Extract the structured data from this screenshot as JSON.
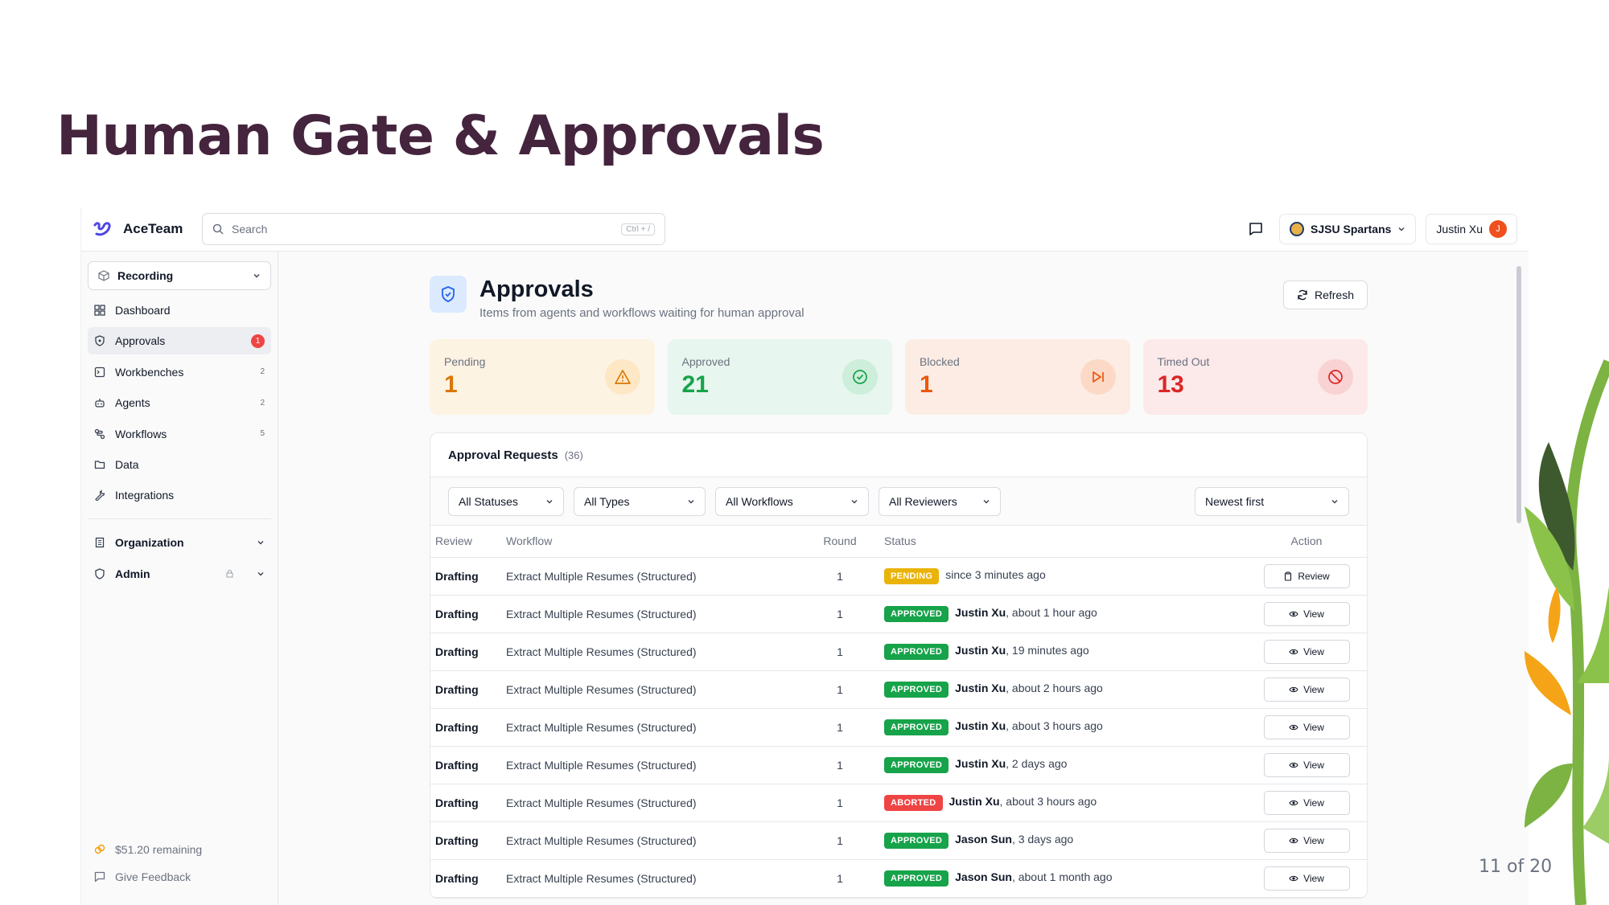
{
  "slide": {
    "title": "Human Gate & Approvals",
    "page": "11 of 20"
  },
  "topbar": {
    "brand": "AceTeam",
    "search_placeholder": "Search",
    "search_shortcut": "Ctrl + /",
    "org": "SJSU Spartans",
    "user": "Justin Xu",
    "user_initial": "J"
  },
  "sidebar": {
    "recording_label": "Recording",
    "items": [
      {
        "label": "Dashboard",
        "icon": "grid-icon"
      },
      {
        "label": "Approvals",
        "icon": "shield-icon",
        "badge": "1"
      },
      {
        "label": "Workbenches",
        "icon": "workbench-icon",
        "count": "2"
      },
      {
        "label": "Agents",
        "icon": "bot-icon",
        "count": "2"
      },
      {
        "label": "Workflows",
        "icon": "workflow-icon",
        "count": "5"
      },
      {
        "label": "Data",
        "icon": "folder-icon"
      },
      {
        "label": "Integrations",
        "icon": "wrench-icon"
      }
    ],
    "groups": [
      {
        "label": "Organization",
        "icon": "building-icon"
      },
      {
        "label": "Admin",
        "icon": "shield-icon"
      }
    ],
    "remaining": "$51.20 remaining",
    "feedback": "Give Feedback"
  },
  "page": {
    "title": "Approvals",
    "subtitle": "Items from agents and workflows waiting for human approval",
    "refresh_label": "Refresh"
  },
  "stats": [
    {
      "label": "Pending",
      "value": "1",
      "color": "#d97706",
      "bg": "#fdf3e2",
      "icon_bg": "#fde7c4"
    },
    {
      "label": "Approved",
      "value": "21",
      "color": "#16a34a",
      "bg": "#e7f6ee",
      "icon_bg": "#cdeedb"
    },
    {
      "label": "Blocked",
      "value": "1",
      "color": "#ea580c",
      "bg": "#fdece4",
      "icon_bg": "#fcd9c7"
    },
    {
      "label": "Timed Out",
      "value": "13",
      "color": "#dc2626",
      "bg": "#fce9ea",
      "icon_bg": "#f9d2d4"
    }
  ],
  "requests": {
    "title": "Approval Requests",
    "count": "(36)",
    "filters": [
      "All Statuses",
      "All Types",
      "All Workflows",
      "All Reviewers"
    ],
    "sort": "Newest first",
    "columns": {
      "review": "Review",
      "workflow": "Workflow",
      "round": "Round",
      "status": "Status",
      "action": "Action"
    },
    "rows": [
      {
        "review": "Drafting",
        "workflow": "Extract Multiple Resumes (Structured)",
        "round": "1",
        "status": "PENDING",
        "kind": "pending",
        "by": "",
        "when": "since 3 minutes ago",
        "action": "Review"
      },
      {
        "review": "Drafting",
        "workflow": "Extract Multiple Resumes (Structured)",
        "round": "1",
        "status": "APPROVED",
        "kind": "approved",
        "by": "Justin Xu",
        "when": ", about 1 hour ago",
        "action": "View"
      },
      {
        "review": "Drafting",
        "workflow": "Extract Multiple Resumes (Structured)",
        "round": "1",
        "status": "APPROVED",
        "kind": "approved",
        "by": "Justin Xu",
        "when": ", 19 minutes ago",
        "action": "View"
      },
      {
        "review": "Drafting",
        "workflow": "Extract Multiple Resumes (Structured)",
        "round": "1",
        "status": "APPROVED",
        "kind": "approved",
        "by": "Justin Xu",
        "when": ", about 2 hours ago",
        "action": "View"
      },
      {
        "review": "Drafting",
        "workflow": "Extract Multiple Resumes (Structured)",
        "round": "1",
        "status": "APPROVED",
        "kind": "approved",
        "by": "Justin Xu",
        "when": ", about 3 hours ago",
        "action": "View"
      },
      {
        "review": "Drafting",
        "workflow": "Extract Multiple Resumes (Structured)",
        "round": "1",
        "status": "APPROVED",
        "kind": "approved",
        "by": "Justin Xu",
        "when": ", 2 days ago",
        "action": "View"
      },
      {
        "review": "Drafting",
        "workflow": "Extract Multiple Resumes (Structured)",
        "round": "1",
        "status": "ABORTED",
        "kind": "aborted",
        "by": "Justin Xu",
        "when": ", about 3 hours ago",
        "action": "View"
      },
      {
        "review": "Drafting",
        "workflow": "Extract Multiple Resumes (Structured)",
        "round": "1",
        "status": "APPROVED",
        "kind": "approved",
        "by": "Jason Sun",
        "when": ", 3 days ago",
        "action": "View"
      },
      {
        "review": "Drafting",
        "workflow": "Extract Multiple Resumes (Structured)",
        "round": "1",
        "status": "APPROVED",
        "kind": "approved",
        "by": "Jason Sun",
        "when": ", about 1 month ago",
        "action": "View"
      }
    ]
  }
}
